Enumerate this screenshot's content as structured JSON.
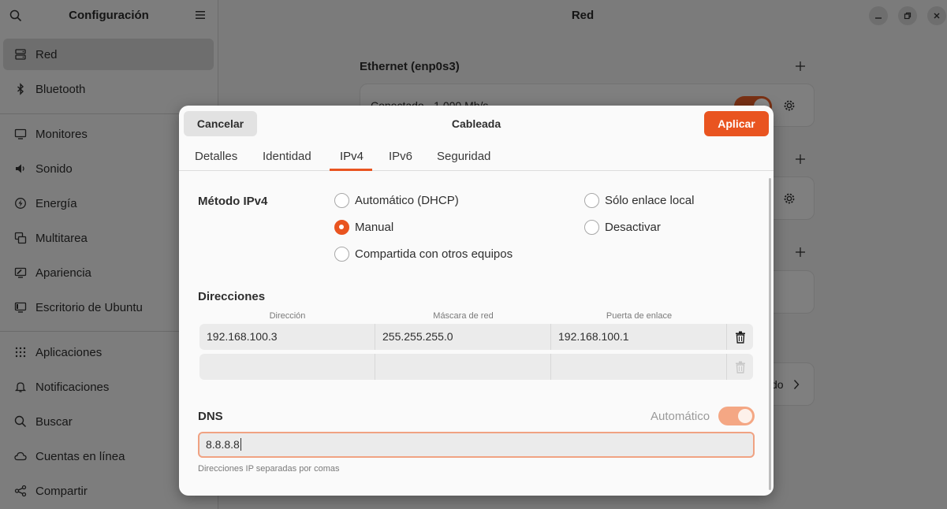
{
  "sidebar": {
    "title": "Configuración",
    "items": [
      {
        "label": "Red",
        "icon": "network-icon",
        "active": true
      },
      {
        "label": "Bluetooth",
        "icon": "bluetooth-icon"
      },
      {
        "label": "Monitores",
        "icon": "monitor-icon"
      },
      {
        "label": "Sonido",
        "icon": "speaker-icon"
      },
      {
        "label": "Energía",
        "icon": "power-icon"
      },
      {
        "label": "Multitarea",
        "icon": "multitask-icon"
      },
      {
        "label": "Apariencia",
        "icon": "appearance-icon"
      },
      {
        "label": "Escritorio de Ubuntu",
        "icon": "ubuntu-desktop-icon"
      },
      {
        "label": "Aplicaciones",
        "icon": "apps-grid-icon"
      },
      {
        "label": "Notificaciones",
        "icon": "bell-icon"
      },
      {
        "label": "Buscar",
        "icon": "search-icon"
      },
      {
        "label": "Cuentas en línea",
        "icon": "cloud-icon"
      },
      {
        "label": "Compartir",
        "icon": "share-icon"
      }
    ]
  },
  "main": {
    "title": "Red",
    "ethernet_title": "Ethernet (enp0s3)",
    "ethernet_status": "Conectado - 1.000 Mb/s",
    "partial_label": "do"
  },
  "dialog": {
    "title": "Cableada",
    "cancel_label": "Cancelar",
    "apply_label": "Aplicar",
    "tabs": [
      "Detalles",
      "Identidad",
      "IPv4",
      "IPv6",
      "Seguridad"
    ],
    "active_tab": "IPv4",
    "method_label": "Método IPv4",
    "methods": {
      "auto": "Automático (DHCP)",
      "link_local": "Sólo enlace local",
      "manual": "Manual",
      "disable": "Desactivar",
      "shared": "Compartida con otros equipos"
    },
    "selected_method": "manual",
    "addresses_label": "Direcciones",
    "columns": {
      "address": "Dirección",
      "netmask": "Máscara de red",
      "gateway": "Puerta de enlace"
    },
    "address_rows": [
      {
        "address": "192.168.100.3",
        "netmask": "255.255.255.0",
        "gateway": "192.168.100.1"
      },
      {
        "address": "",
        "netmask": "",
        "gateway": ""
      }
    ],
    "dns_label": "DNS",
    "dns_auto_label": "Automático",
    "dns_auto_on": true,
    "dns_value": "8.8.8.8",
    "dns_hint": "Direcciones IP separadas por comas"
  },
  "colors": {
    "accent": "#e95420",
    "accent_light": "#f4a784"
  }
}
